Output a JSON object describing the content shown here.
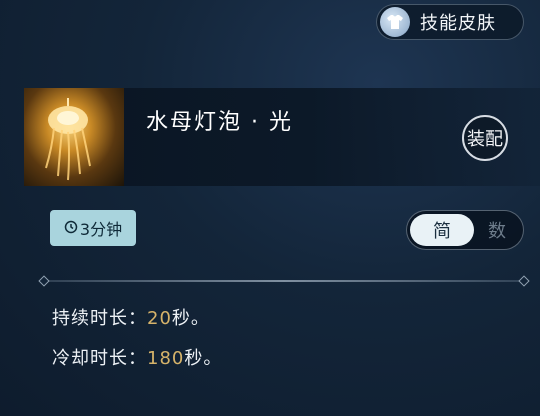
{
  "header": {
    "skin_button_label": "技能皮肤"
  },
  "item": {
    "name": "水母灯泡 · 光",
    "equip_label": "装配"
  },
  "duration": {
    "label": "3分钟"
  },
  "view_toggle": {
    "simple_label": "简",
    "detailed_label": "数"
  },
  "stats": [
    {
      "label": "持续时长：",
      "value": "20",
      "unit": "秒。"
    },
    {
      "label": "冷却时长：",
      "value": "180",
      "unit": "秒。"
    }
  ],
  "colors": {
    "accent_value": "#d6b36a",
    "badge_bg": "#a9d4dd"
  },
  "icons": {
    "skin": "shirt-icon",
    "timer": "timer-icon"
  }
}
